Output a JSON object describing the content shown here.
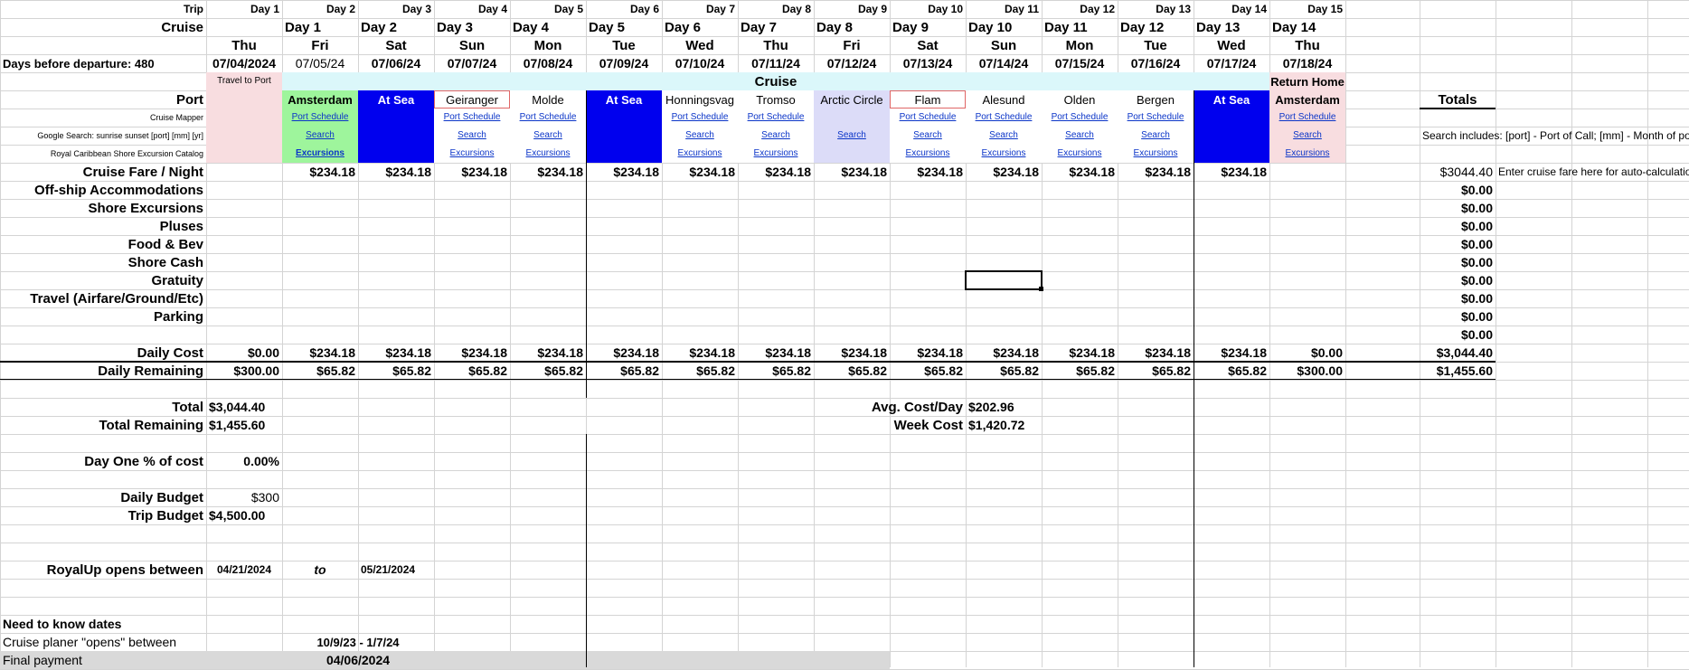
{
  "colors": {
    "grid": "#d4d4d4",
    "pink": "#f8dde0",
    "green": "#9ef59c",
    "blue": "#0000ee",
    "lavender": "#dcdcf8",
    "cyan": "#dbf7fa",
    "gray": "#d9d9d9",
    "link": "#0b35c8",
    "red_border": "#e06666"
  },
  "header": {
    "trip_label": "Trip",
    "trip_days": [
      "Day 1",
      "Day 2",
      "Day 3",
      "Day 4",
      "Day 5",
      "Day 6",
      "Day 7",
      "Day 8",
      "Day 9",
      "Day 10",
      "Day 11",
      "Day 12",
      "Day 13",
      "Day 14",
      "Day 15"
    ],
    "cruise_label": "Cruise",
    "cruise_days": [
      "",
      "Day 1",
      "Day 2",
      "Day 3",
      "Day 4",
      "Day 5",
      "Day 6",
      "Day 7",
      "Day 8",
      "Day 9",
      "Day 10",
      "Day 11",
      "Day 12",
      "Day 13",
      "Day 14"
    ],
    "weekdays": [
      "Thu",
      "Fri",
      "Sat",
      "Sun",
      "Mon",
      "Tue",
      "Wed",
      "Thu",
      "Fri",
      "Sat",
      "Sun",
      "Mon",
      "Tue",
      "Wed",
      "Thu"
    ],
    "days_before_departure": "Days before departure: 480",
    "dates": [
      "07/04/2024",
      "07/05/24",
      "07/06/24",
      "07/07/24",
      "07/08/24",
      "07/09/24",
      "07/10/24",
      "07/11/24",
      "07/12/24",
      "07/13/24",
      "07/14/24",
      "07/15/24",
      "07/16/24",
      "07/17/24",
      "07/18/24"
    ]
  },
  "segments": {
    "travel_to_port": "Travel to Port",
    "cruise": "Cruise",
    "return_home": "Return Home"
  },
  "port_label": "Port",
  "ports": [
    "",
    "Amsterdam",
    "At Sea",
    "Geiranger",
    "Molde",
    "At Sea",
    "Honningsvag",
    "Tromso",
    "Arctic Circle",
    "Flam",
    "Alesund",
    "Olden",
    "Bergen",
    "At Sea",
    "Amsterdam"
  ],
  "link_rows": [
    {
      "label": "Cruise Mapper",
      "cells": [
        "",
        "Port Schedule",
        "",
        "Port Schedule",
        "Port Schedule",
        "",
        "Port Schedule",
        "Port Schedule",
        "",
        "Port Schedule",
        "Port Schedule",
        "Port Schedule",
        "Port Schedule",
        "",
        "Port Schedule"
      ]
    },
    {
      "label": "Google Search: sunrise sunset [port] [mm] [yr]",
      "cells": [
        "",
        "Search",
        "",
        "Search",
        "Search",
        "",
        "Search",
        "Search",
        "Search",
        "Search",
        "Search",
        "Search",
        "Search",
        "",
        "Search"
      ]
    },
    {
      "label": "Royal Caribbean Shore Excursion Catalog",
      "cells": [
        "",
        "Excursions",
        "",
        "Excursions",
        "Excursions",
        "",
        "Excursions",
        "Excursions",
        "",
        "Excursions",
        "Excursions",
        "Excursions",
        "Excursions",
        "",
        "Excursions"
      ]
    }
  ],
  "totals_header": "Totals",
  "search_note": "Search includes: [port] - Port of Call; [mm] - Month of port",
  "expense_rows": [
    {
      "label": "Cruise Fare / Night",
      "total": "$3044.40",
      "values": [
        "",
        "$234.18",
        "$234.18",
        "$234.18",
        "$234.18",
        "$234.18",
        "$234.18",
        "$234.18",
        "$234.18",
        "$234.18",
        "$234.18",
        "$234.18",
        "$234.18",
        "$234.18",
        ""
      ]
    },
    {
      "label": "Off-ship Accommodations",
      "total": "$0.00"
    },
    {
      "label": "Shore Excursions",
      "total": "$0.00"
    },
    {
      "label": "Pluses",
      "total": "$0.00"
    },
    {
      "label": "Food & Bev",
      "total": "$0.00"
    },
    {
      "label": "Shore Cash",
      "total": "$0.00"
    },
    {
      "label": "Gratuity",
      "total": "$0.00"
    },
    {
      "label": "Travel (Airfare/Ground/Etc)",
      "total": "$0.00"
    },
    {
      "label": "Parking",
      "total": "$0.00"
    },
    {
      "label": "",
      "total": "$0.00"
    }
  ],
  "fare_note": "Enter cruise fare here for auto-calculation",
  "daily_cost": {
    "label": "Daily Cost",
    "values": [
      "$0.00",
      "$234.18",
      "$234.18",
      "$234.18",
      "$234.18",
      "$234.18",
      "$234.18",
      "$234.18",
      "$234.18",
      "$234.18",
      "$234.18",
      "$234.18",
      "$234.18",
      "$234.18",
      "$0.00"
    ],
    "total": "$3,044.40"
  },
  "daily_remaining": {
    "label": "Daily Remaining",
    "values": [
      "$300.00",
      "$65.82",
      "$65.82",
      "$65.82",
      "$65.82",
      "$65.82",
      "$65.82",
      "$65.82",
      "$65.82",
      "$65.82",
      "$65.82",
      "$65.82",
      "$65.82",
      "$65.82",
      "$300.00"
    ],
    "total": "$1,455.60"
  },
  "summary": {
    "total_label": "Total",
    "total_value": "$3,044.40",
    "total_remaining_label": "Total Remaining",
    "total_remaining_value": "$1,455.60",
    "avg_cost_label": "Avg. Cost/Day",
    "avg_cost_value": "$202.96",
    "week_cost_label": "Week Cost",
    "week_cost_value": "$1,420.72",
    "day_one_label": "Day One % of cost",
    "day_one_value": "0.00%",
    "daily_budget_label": "Daily Budget",
    "daily_budget_value": "$300",
    "trip_budget_label": "Trip Budget",
    "trip_budget_value": "$4,500.00"
  },
  "royalup": {
    "label": "RoyalUp opens between",
    "from": "04/21/2024",
    "to_word": "to",
    "to": "05/21/2024"
  },
  "dates_section": {
    "title": "Need to know dates",
    "planner_label": "Cruise planer \"opens\" between",
    "planner_value": "10/9/23 - 1/7/24",
    "final_label": "Final payment",
    "final_value": "04/06/2024"
  }
}
